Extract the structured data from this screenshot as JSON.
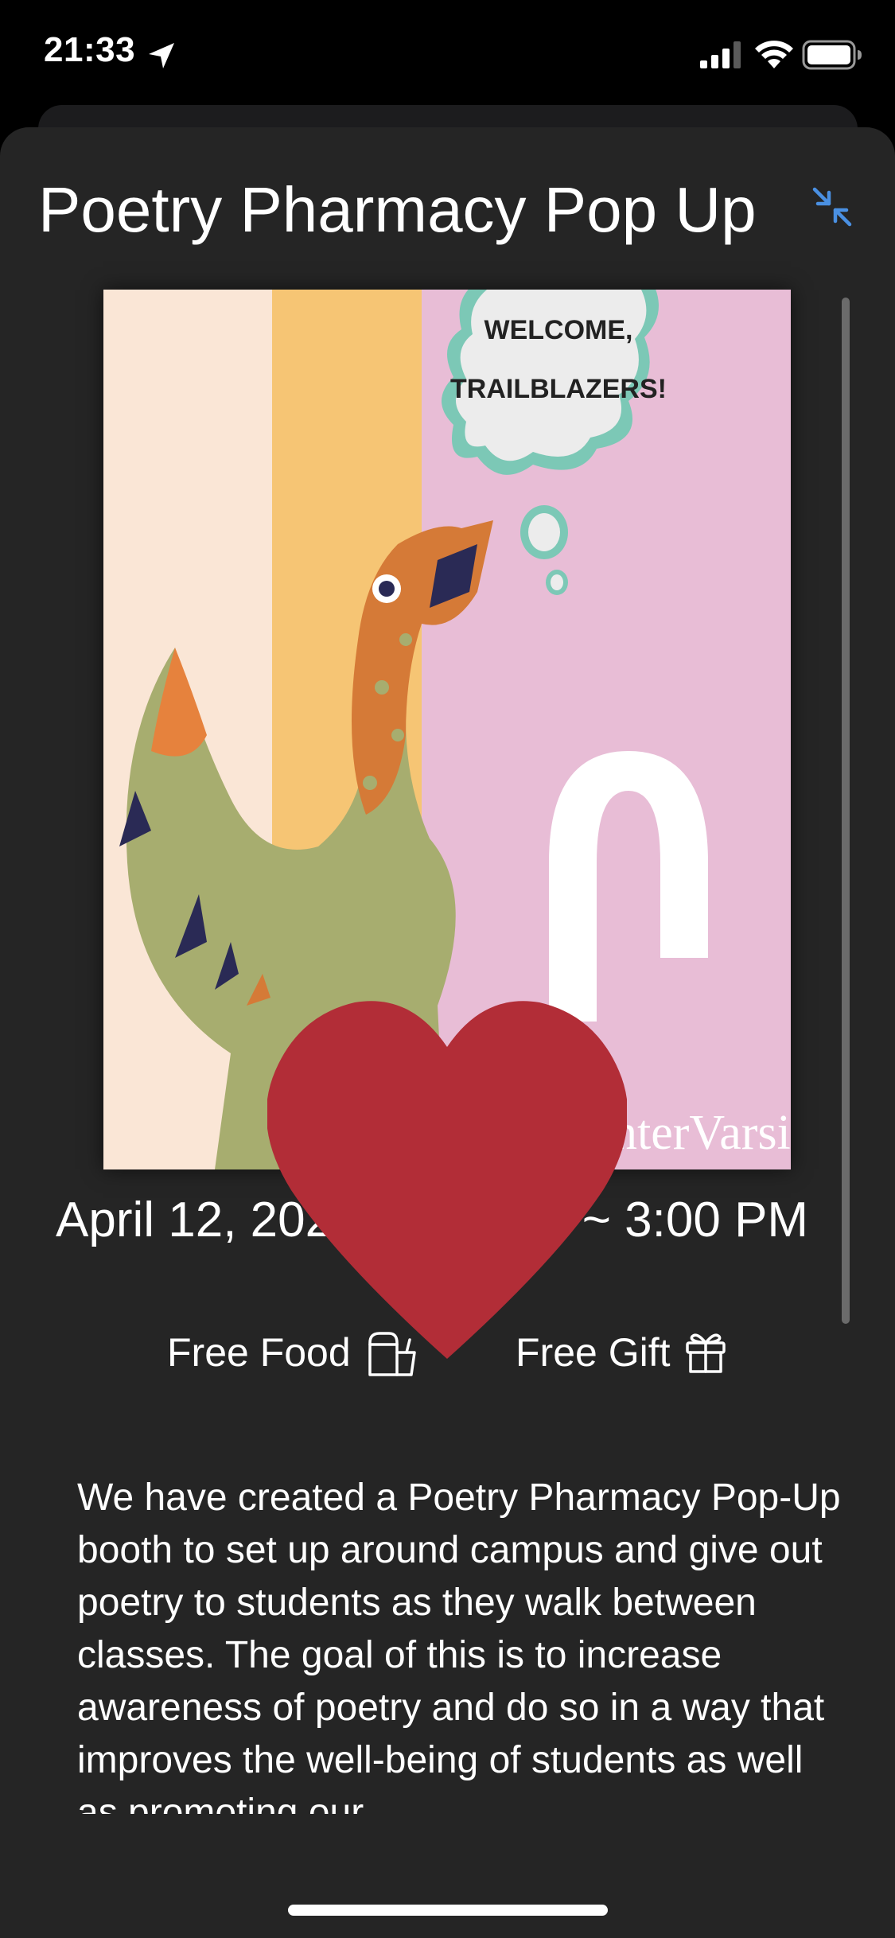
{
  "status_bar": {
    "time": "21:33"
  },
  "event": {
    "title": "Poetry Pharmacy Pop Up",
    "poster": {
      "speech_line1": "WELCOME,",
      "speech_line2": "TRAILBLAZERS!",
      "brand_text": "nterVarsity"
    },
    "datetime": "April 12, 2022, 9:00 AM ~ 3:00 PM",
    "tags": [
      {
        "label": "Free Food",
        "icon": "food-drink-icon"
      },
      {
        "label": "Free Gift",
        "icon": "gift-icon"
      }
    ],
    "description": "We have created a Poetry Pharmacy Pop-Up booth to set up around campus and give out poetry to students as they walk between classes. The goal of this is to increase awareness of poetry and do so in a way that improves the well-being of students as well as promoting our"
  },
  "colors": {
    "sheet_bg": "#252525",
    "accent": "#4a90e2",
    "heart": "#b22d37"
  }
}
